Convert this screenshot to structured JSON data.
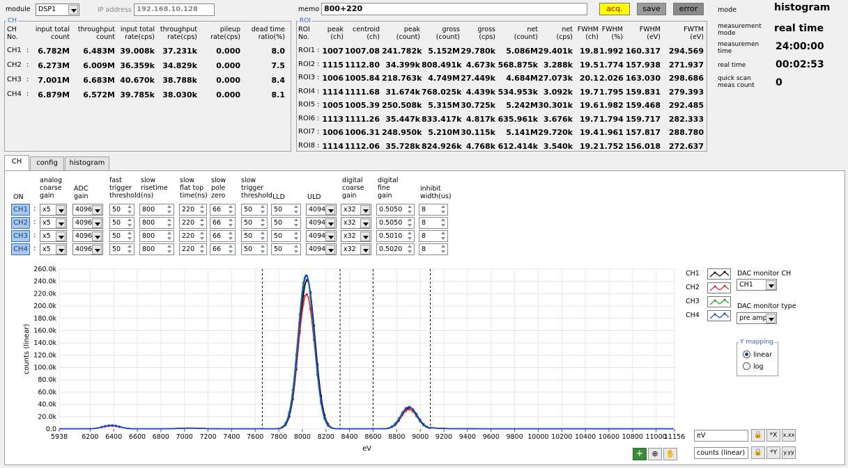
{
  "top": {
    "module_label": "module",
    "module_value": "DSP1",
    "ip_label": "IP address",
    "ip_value": "192.168.10.128",
    "memo_label": "memo",
    "memo_value": "800+220",
    "acq_label": "acq.",
    "save_label": "save",
    "error_label": "error"
  },
  "ch_panel": {
    "legend": "CH",
    "headers": [
      "CH\nNo.",
      "input total\ncount",
      "throughput\ncount",
      "input total\nrate(cps)",
      "throughput\nrate(cps)",
      "pileup\nrate(cps)",
      "dead time\nratio(%)"
    ],
    "rows": [
      [
        "CH1",
        "6.782M",
        "6.483M",
        "39.008k",
        "37.231k",
        "0.000",
        "8.0"
      ],
      [
        "CH2",
        "6.273M",
        "6.009M",
        "36.359k",
        "34.829k",
        "0.000",
        "7.5"
      ],
      [
        "CH3",
        "7.001M",
        "6.683M",
        "40.670k",
        "38.788k",
        "0.000",
        "8.4"
      ],
      [
        "CH4",
        "6.879M",
        "6.572M",
        "39.785k",
        "38.030k",
        "0.000",
        "8.1"
      ]
    ]
  },
  "roi_panel": {
    "legend": "ROI",
    "headers": [
      "ROI\nNo.",
      "peak\n(ch)",
      "centroid\n(ch)",
      "peak\n(count)",
      "gross\n(count)",
      "gross\n(cps)",
      "net\n(count)",
      "net\n(cps)",
      "FWHM\n(ch)",
      "FWHM\n(%)",
      "FWHM\n(eV)",
      "FWTM\n(eV)"
    ],
    "rows": [
      [
        "ROI1",
        "1007",
        "1007.08",
        "241.782k",
        "5.152M",
        "29.780k",
        "5.086M",
        "29.401k",
        "19.8",
        "1.992",
        "160.317",
        "294.569"
      ],
      [
        "ROI2",
        "1115",
        "1112.80",
        "34.399k",
        "808.491k",
        "4.673k",
        "568.875k",
        "3.288k",
        "19.5",
        "1.774",
        "157.938",
        "271.937"
      ],
      [
        "ROI3",
        "1006",
        "1005.84",
        "218.763k",
        "4.749M",
        "27.449k",
        "4.684M",
        "27.073k",
        "20.1",
        "2.026",
        "163.030",
        "298.686"
      ],
      [
        "ROI4",
        "1114",
        "1111.68",
        "31.674k",
        "768.025k",
        "4.439k",
        "534.953k",
        "3.092k",
        "19.7",
        "1.795",
        "159.831",
        "279.393"
      ],
      [
        "ROI5",
        "1005",
        "1005.39",
        "250.508k",
        "5.315M",
        "30.725k",
        "5.242M",
        "30.301k",
        "19.6",
        "1.982",
        "159.468",
        "292.485"
      ],
      [
        "ROI6",
        "1113",
        "1111.26",
        "35.447k",
        "833.417k",
        "4.817k",
        "635.961k",
        "3.676k",
        "19.7",
        "1.794",
        "159.717",
        "282.333"
      ],
      [
        "ROI7",
        "1006",
        "1006.31",
        "248.950k",
        "5.210M",
        "30.115k",
        "5.141M",
        "29.720k",
        "19.4",
        "1.961",
        "157.817",
        "288.780"
      ],
      [
        "ROI8",
        "1114",
        "1112.06",
        "35.728k",
        "824.926k",
        "4.768k",
        "612.414k",
        "3.540k",
        "19.2",
        "1.752",
        "156.018",
        "272.637"
      ]
    ]
  },
  "status": {
    "mode_label": "mode",
    "mode_value": "histogram",
    "meas_mode_label": "measurement\nmode",
    "meas_mode_value": "real time",
    "meas_time_label": "measuremen\ntime",
    "meas_time_value": "24:00:00",
    "real_time_label": "real time",
    "real_time_value": "00:02:53",
    "quick_label": "quick scan\nmeas count",
    "quick_value": "0"
  },
  "tabs": [
    "CH",
    "config",
    "histogram"
  ],
  "settings": {
    "headers": [
      "ON",
      "analog\ncoarse\ngain",
      "ADC\ngain",
      "fast\ntrigger\nthreshold",
      "slow\nrisetime\n(ns)",
      "slow\nflat top\ntime(ns)",
      "slow\npole\nzero",
      "slow\ntrigger\nthreshold",
      "LLD",
      "ULD",
      "digital\ncoarse\ngain",
      "digital\nfine\ngain",
      "inhibit\nwidth(us)"
    ],
    "rows": [
      {
        "ch": "CH1",
        "coarse": "x5",
        "adc": "4096",
        "fast": "50",
        "rise": "800",
        "flat": "220",
        "pz": "66",
        "strig": "50",
        "lld": "50",
        "uld": "4094",
        "dcoarse": "x32",
        "dfine": "0.5050",
        "inhibit": "8"
      },
      {
        "ch": "CH2",
        "coarse": "x5",
        "adc": "4096",
        "fast": "50",
        "rise": "800",
        "flat": "220",
        "pz": "66",
        "strig": "50",
        "lld": "50",
        "uld": "4094",
        "dcoarse": "x32",
        "dfine": "0.5050",
        "inhibit": "8"
      },
      {
        "ch": "CH3",
        "coarse": "x5",
        "adc": "4096",
        "fast": "50",
        "rise": "800",
        "flat": "220",
        "pz": "66",
        "strig": "50",
        "lld": "50",
        "uld": "4094",
        "dcoarse": "x32",
        "dfine": "0.5010",
        "inhibit": "8"
      },
      {
        "ch": "CH4",
        "coarse": "x5",
        "adc": "4096",
        "fast": "50",
        "rise": "800",
        "flat": "220",
        "pz": "66",
        "strig": "50",
        "lld": "50",
        "uld": "4094",
        "dcoarse": "x32",
        "dfine": "0.5020",
        "inhibit": "8"
      }
    ]
  },
  "legend_panel": {
    "channels": [
      "CH1",
      "CH2",
      "CH3",
      "CH4"
    ],
    "dac_ch_label": "DAC monitor CH",
    "dac_ch_value": "CH1",
    "dac_type_label": "DAC monitor type",
    "dac_type_value": "pre amp",
    "ymap_label": "Y mapping",
    "ymap_linear": "linear",
    "ymap_log": "log",
    "x_name": "eV",
    "y_name": "counts (linear)"
  },
  "chart_data": {
    "type": "line",
    "xlabel": "eV",
    "ylabel": "counts (linear)",
    "xlim": [
      5938,
      11156
    ],
    "ylim": [
      0,
      260000
    ],
    "x_ticks": [
      "5938",
      "6200",
      "6400",
      "6600",
      "6800",
      "7000",
      "7200",
      "7400",
      "7600",
      "7800",
      "8000",
      "8200",
      "8400",
      "8600",
      "8800",
      "9000",
      "9200",
      "9400",
      "9600",
      "9800",
      "10000",
      "10200",
      "10400",
      "10600",
      "10800",
      "11000",
      "11156"
    ],
    "y_ticks": [
      "0.0",
      "20.0k",
      "40.0k",
      "60.0k",
      "80.0k",
      "100.0k",
      "120.0k",
      "140.0k",
      "160.0k",
      "180.0k",
      "200.0k",
      "220.0k",
      "240.0k",
      "260.0k"
    ],
    "roi_markers_eV": [
      7660,
      8320,
      8600,
      9085
    ],
    "series": [
      {
        "name": "CH1",
        "color": "#000000",
        "peaks": [
          {
            "x": 8040,
            "y": 241782,
            "fwhm": 160
          },
          {
            "x": 8910,
            "y": 34399,
            "fwhm": 158
          },
          {
            "x": 6380,
            "y": 5500,
            "fwhm": 170
          },
          {
            "x": 7050,
            "y": 1200,
            "fwhm": 250
          }
        ]
      },
      {
        "name": "CH2",
        "color": "#e02020",
        "peaks": [
          {
            "x": 8035,
            "y": 218763,
            "fwhm": 163
          },
          {
            "x": 8905,
            "y": 31674,
            "fwhm": 160
          },
          {
            "x": 6380,
            "y": 5000,
            "fwhm": 170
          },
          {
            "x": 7050,
            "y": 1100,
            "fwhm": 250
          }
        ]
      },
      {
        "name": "CH3",
        "color": "#20a020",
        "peaks": [
          {
            "x": 8030,
            "y": 250508,
            "fwhm": 159
          },
          {
            "x": 8900,
            "y": 35447,
            "fwhm": 160
          },
          {
            "x": 6380,
            "y": 5800,
            "fwhm": 170
          },
          {
            "x": 7050,
            "y": 1200,
            "fwhm": 250
          }
        ]
      },
      {
        "name": "CH4",
        "color": "#2040e0",
        "peaks": [
          {
            "x": 8035,
            "y": 248950,
            "fwhm": 158
          },
          {
            "x": 8905,
            "y": 35728,
            "fwhm": 156
          },
          {
            "x": 6380,
            "y": 5600,
            "fwhm": 170
          },
          {
            "x": 7050,
            "y": 1200,
            "fwhm": 250
          }
        ]
      }
    ],
    "tail_after": 9085
  }
}
